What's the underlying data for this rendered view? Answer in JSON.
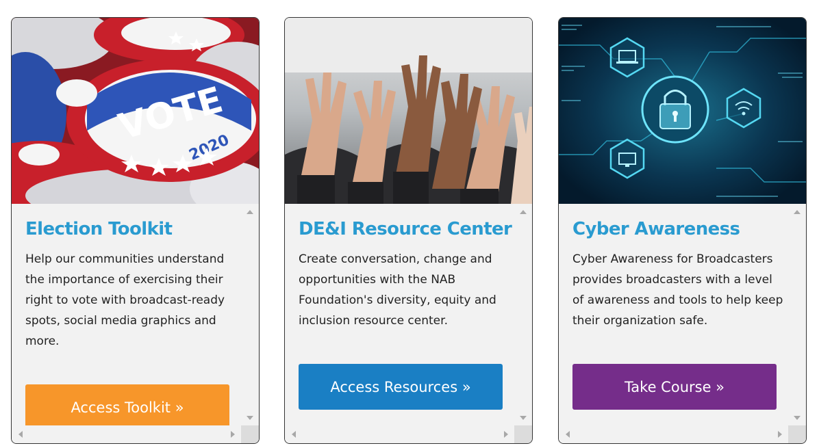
{
  "cards": [
    {
      "image_icon": "vote-buttons-image",
      "title": "Election Toolkit",
      "description": "Help our communities understand the importance of exercising their right to vote with broadcast-ready spots, social media graphics and more.",
      "button_label": "Access Toolkit »",
      "button_color": "#f7962a"
    },
    {
      "image_icon": "raised-hands-image",
      "title": "DE&I Resource Center",
      "description": "Create conversation, change and opportunities with the NAB Foundation's diversity, equity and inclusion resource center.",
      "button_label": "Access Resources »",
      "button_color": "#1a7fc4"
    },
    {
      "image_icon": "cyber-lock-image",
      "title": "Cyber Awareness",
      "description": "Cyber Awareness for Broadcasters provides broadcasters with a level of awareness and tools to help keep their organization safe.",
      "button_label": "Take Course »",
      "button_color": "#752d8a"
    }
  ],
  "image_text": {
    "vote_word": "VOTE",
    "vote_year": "2020"
  },
  "colors": {
    "title": "#2a9bd0",
    "card_background": "#f2f2f2"
  }
}
